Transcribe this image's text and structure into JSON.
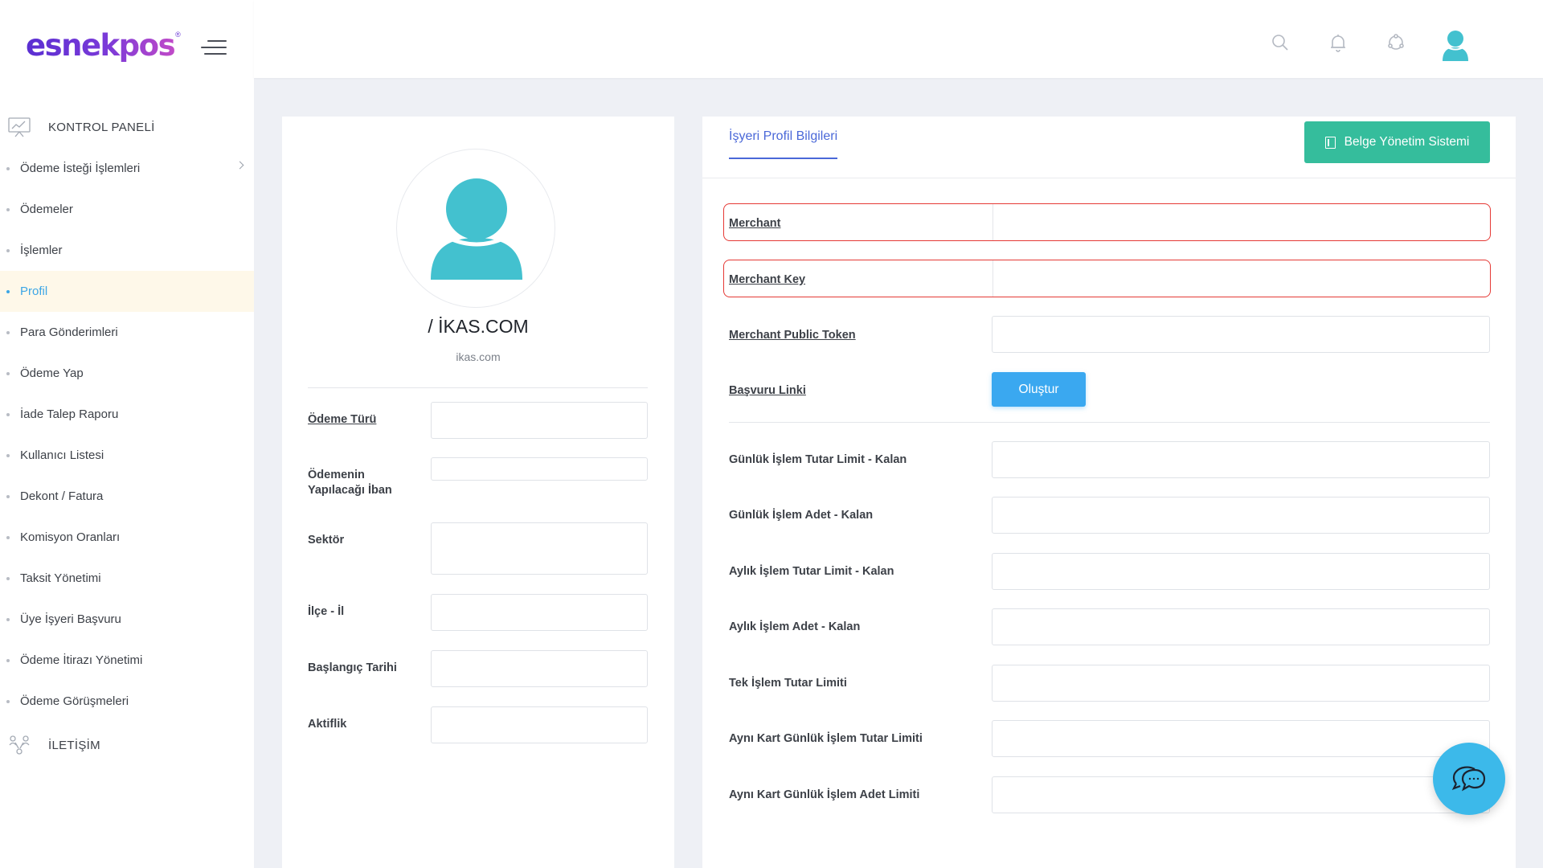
{
  "brand": {
    "logo_text": "esnekpos",
    "reg": "®"
  },
  "sidebar": {
    "section_dashboard": "KONTROL PANELİ",
    "section_contact": "İLETİŞİM",
    "items": [
      {
        "label": "Ödeme İsteği İşlemleri",
        "has_submenu": true
      },
      {
        "label": "Ödemeler"
      },
      {
        "label": "İşlemler"
      },
      {
        "label": "Profil",
        "active": true
      },
      {
        "label": "Para Gönderimleri"
      },
      {
        "label": "Ödeme Yap"
      },
      {
        "label": "İade Talep Raporu"
      },
      {
        "label": "Kullanıcı Listesi"
      },
      {
        "label": "Dekont / Fatura"
      },
      {
        "label": "Komisyon Oranları"
      },
      {
        "label": "Taksit Yönetimi"
      },
      {
        "label": "Üye İşyeri Başvuru"
      },
      {
        "label": "Ödeme İtirazı Yönetimi"
      },
      {
        "label": "Ödeme Görüşmeleri"
      }
    ]
  },
  "header": {
    "icons": [
      "search-icon",
      "bell-icon",
      "sync-icon",
      "user-avatar-icon"
    ]
  },
  "profile": {
    "company_name": "/ İKAS.COM",
    "domain": "ikas.com",
    "fields": {
      "payment_type": "Ödeme Türü",
      "iban_line1": "Ödemenin",
      "iban_line2": "Yapılacağı İban",
      "sector": "Sektör",
      "district": "İlçe - İl",
      "start_date": "Başlangıç Tarihi",
      "active": "Aktiflik"
    }
  },
  "main": {
    "tab_label": "İşyeri Profil Bilgileri",
    "doc_button": "Belge Yönetim Sistemi",
    "create_button": "Oluştur",
    "labels": {
      "merchant": "Merchant",
      "merchant_key": "Merchant Key",
      "merchant_public_token": "Merchant Public Token",
      "application_link": "Başvuru Linki",
      "daily_amount_limit": "Günlük İşlem Tutar Limit - Kalan",
      "daily_count": "Günlük İşlem Adet - Kalan",
      "monthly_amount_limit": "Aylık İşlem Tutar Limit - Kalan",
      "monthly_count": "Aylık İşlem Adet - Kalan",
      "single_limit": "Tek İşlem Tutar Limiti",
      "same_card_daily_amount": "Aynı Kart Günlük İşlem Tutar Limiti",
      "same_card_daily_count": "Aynı Kart Günlük İşlem Adet Limiti"
    }
  },
  "colors": {
    "accent": "#4a68d8",
    "active_nav": "#3ca6e6",
    "active_bg": "#fef8e9",
    "teal_button": "#35bd9c",
    "blue_button": "#3aa8f0",
    "highlight_border": "#e53935",
    "avatar": "#43c1cf",
    "chat_fab": "#3cb9ea"
  }
}
